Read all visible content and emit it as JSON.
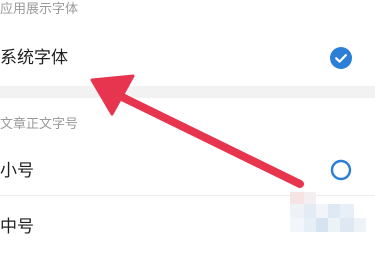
{
  "font_section": {
    "header": "应用展示字体",
    "options": [
      {
        "label": "系统字体",
        "selected": true
      }
    ]
  },
  "size_section": {
    "header": "文章正文字号",
    "options": [
      {
        "label": "小号",
        "selected": false
      },
      {
        "label": "中号",
        "selected": false
      }
    ]
  },
  "annotation": {
    "arrow_color": "#e8354f"
  },
  "colors": {
    "accent": "#2b7fd6",
    "header_text": "#9a9a9a",
    "body_text": "#1f1f1f"
  }
}
